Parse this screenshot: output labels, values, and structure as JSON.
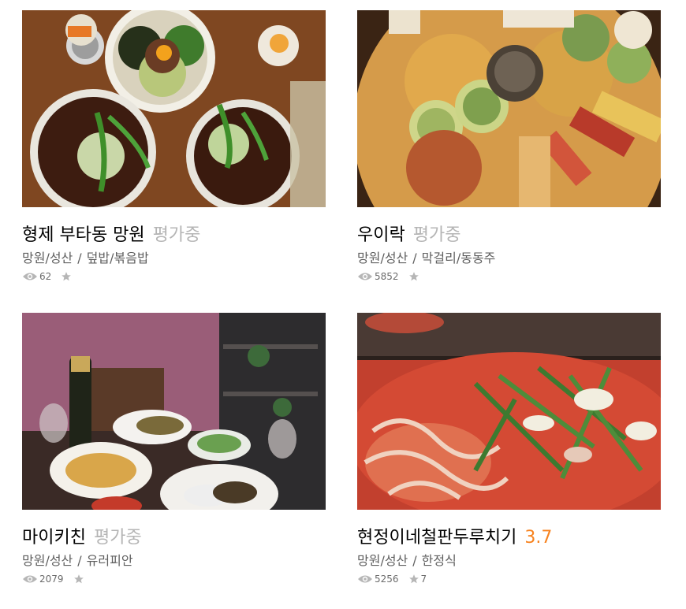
{
  "colors": {
    "pending": "#b5b5b5",
    "rated": "#f7821e",
    "meta": "#5f5f5f",
    "icon": "#b6b6b6"
  },
  "icons": {
    "views": "eye-icon",
    "rating": "star-icon"
  },
  "restaurants": [
    {
      "name": "형제 부타동 망원",
      "score": "평가중",
      "score_state": "pending",
      "area": "망원/성산",
      "category": "덮밥/볶음밥",
      "views": "62",
      "reviews": ""
    },
    {
      "name": "우이락",
      "score": "평가중",
      "score_state": "pending",
      "area": "망원/성산",
      "category": "막걸리/동동주",
      "views": "5852",
      "reviews": ""
    },
    {
      "name": "마이키친",
      "score": "평가중",
      "score_state": "pending",
      "area": "망원/성산",
      "category": "유러피안",
      "views": "2079",
      "reviews": ""
    },
    {
      "name": "현정이네철판두루치기",
      "score": "3.7",
      "score_state": "rated",
      "area": "망원/성산",
      "category": "한정식",
      "views": "5256",
      "reviews": "7"
    }
  ]
}
